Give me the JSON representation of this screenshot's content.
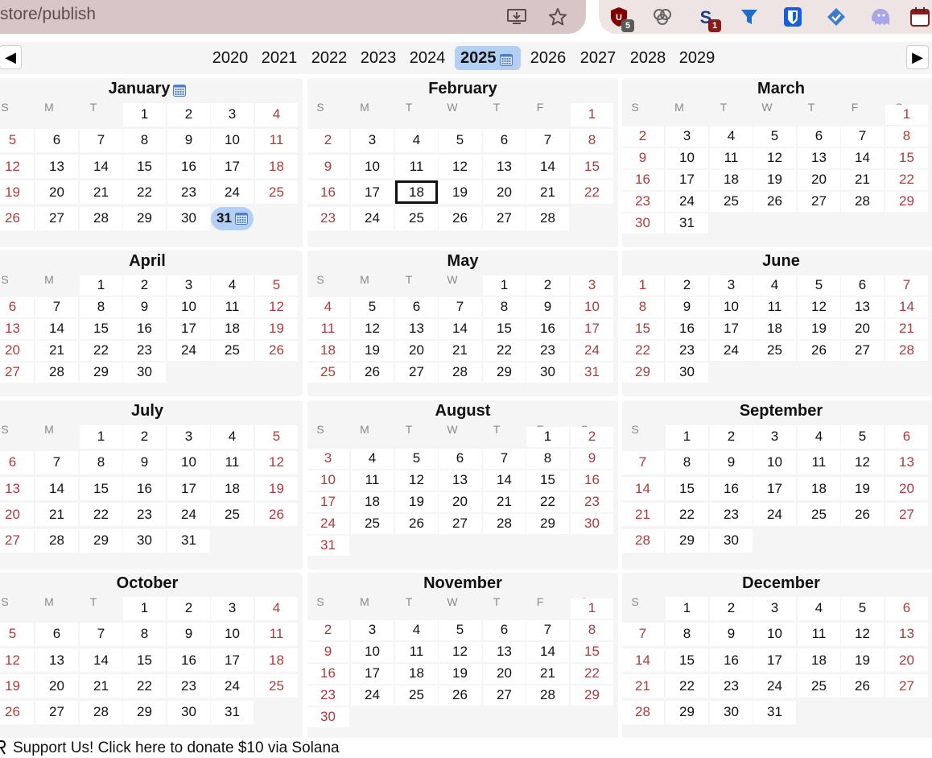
{
  "browser": {
    "url_text": "store/publish",
    "extensions": [
      {
        "name": "ublock-icon",
        "badge": "5"
      },
      {
        "name": "cloud-icon",
        "badge": ""
      },
      {
        "name": "s-extension-icon",
        "badge": "1"
      },
      {
        "name": "filter-icon",
        "badge": ""
      },
      {
        "name": "bitwarden-icon",
        "badge": ""
      },
      {
        "name": "check-badge-icon",
        "badge": ""
      },
      {
        "name": "ghost-icon",
        "badge": ""
      },
      {
        "name": "calendar-extension-icon",
        "badge": ""
      }
    ]
  },
  "years": {
    "prev_label": "◀",
    "next_label": "▶",
    "list": [
      "2020",
      "2021",
      "2022",
      "2023",
      "2024",
      "2025",
      "2026",
      "2027",
      "2028",
      "2029"
    ],
    "current": "2025"
  },
  "weekday_labels": [
    "S",
    "M",
    "T",
    "W",
    "T",
    "F",
    "S"
  ],
  "months": [
    {
      "name": "January",
      "start": 3,
      "days": 31,
      "has_icon": true
    },
    {
      "name": "February",
      "start": 6,
      "days": 28,
      "has_icon": false
    },
    {
      "name": "March",
      "start": 6,
      "days": 31,
      "has_icon": false
    },
    {
      "name": "April",
      "start": 2,
      "days": 30,
      "has_icon": false
    },
    {
      "name": "May",
      "start": 4,
      "days": 31,
      "has_icon": false
    },
    {
      "name": "June",
      "start": 0,
      "days": 30,
      "has_icon": false
    },
    {
      "name": "July",
      "start": 2,
      "days": 31,
      "has_icon": false
    },
    {
      "name": "August",
      "start": 5,
      "days": 31,
      "has_icon": false
    },
    {
      "name": "September",
      "start": 1,
      "days": 30,
      "has_icon": false
    },
    {
      "name": "October",
      "start": 3,
      "days": 31,
      "has_icon": false
    },
    {
      "name": "November",
      "start": 6,
      "days": 30,
      "has_icon": false
    },
    {
      "name": "December",
      "start": 1,
      "days": 31,
      "has_icon": false
    }
  ],
  "today": {
    "month": 1,
    "day": 18
  },
  "highlight": {
    "month": 0,
    "day": 31
  },
  "footer": {
    "text": "Support Us! Click here to donate $10 via Solana"
  },
  "colors": {
    "weekend": "#b03a3a",
    "highlight": "#b3cff3",
    "panel": "#f5f5f5"
  }
}
